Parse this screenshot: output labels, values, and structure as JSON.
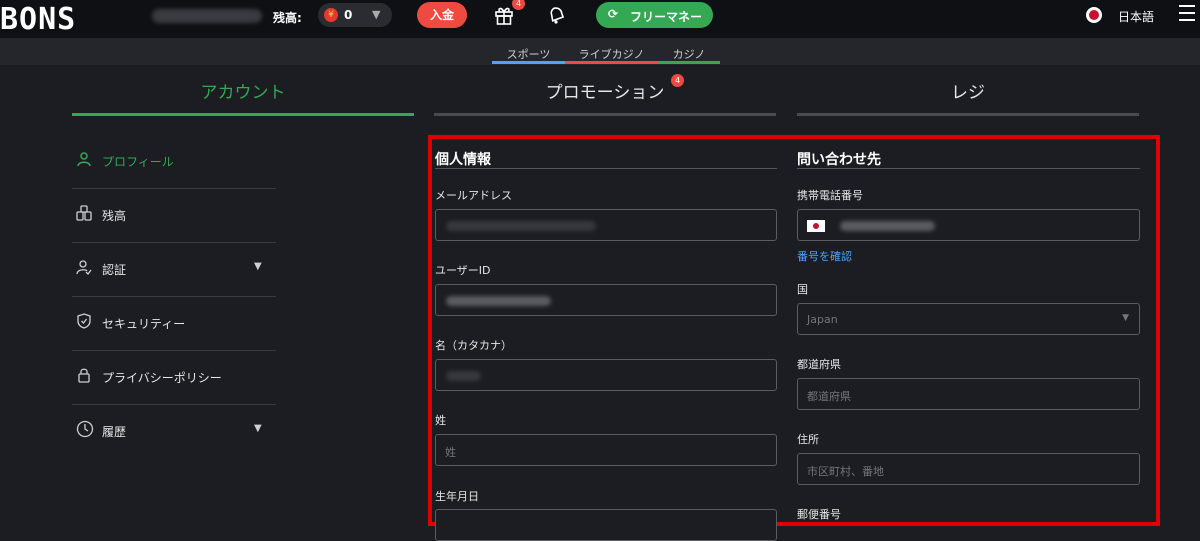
{
  "header": {
    "logo": "BONS",
    "balance_label": "残高:",
    "currency_symbol": "¥",
    "balance_value": "0",
    "deposit_label": "入金",
    "gift_badge": "4",
    "free_money_label": "フリーマネー",
    "language_label": "日本語"
  },
  "subnav": {
    "tabs": [
      {
        "label": "スポーツ",
        "color": "#4da3ff"
      },
      {
        "label": "ライブカジノ",
        "color": "#ef4a3f"
      },
      {
        "label": "カジノ",
        "color": "#34a853"
      }
    ]
  },
  "main_tabs": [
    {
      "label": "アカウント",
      "active": true
    },
    {
      "label": "プロモーション",
      "badge": "4"
    },
    {
      "label": "レジ"
    }
  ],
  "sidebar": {
    "items": [
      {
        "label": "プロフィール",
        "icon": "user-icon",
        "active": true
      },
      {
        "label": "残高",
        "icon": "coins-icon"
      },
      {
        "label": "認証",
        "icon": "user-check-icon",
        "expandable": true
      },
      {
        "label": "セキュリティー",
        "icon": "shield-icon"
      },
      {
        "label": "プライバシーポリシー",
        "icon": "lock-icon"
      },
      {
        "label": "履歴",
        "icon": "history-icon",
        "expandable": true
      }
    ]
  },
  "personal": {
    "title": "個人情報",
    "email_label": "メールアドレス",
    "userid_label": "ユーザーID",
    "firstname_label": "名（カタカナ）",
    "lastname_label": "姓",
    "lastname_placeholder": "姓",
    "birthdate_label": "生年月日"
  },
  "contact": {
    "title": "問い合わせ先",
    "phone_label": "携帯電話番号",
    "verify_link": "番号を確認",
    "country_label": "国",
    "country_value": "Japan",
    "prefecture_label": "都道府県",
    "prefecture_placeholder": "都道府県",
    "address_label": "住所",
    "address_placeholder": "市区町村、番地",
    "postal_label": "郵便番号"
  },
  "colors": {
    "accent_green": "#34a853",
    "accent_red": "#ef4a3f",
    "highlight": "#e00000",
    "link_blue": "#4da3ff"
  }
}
